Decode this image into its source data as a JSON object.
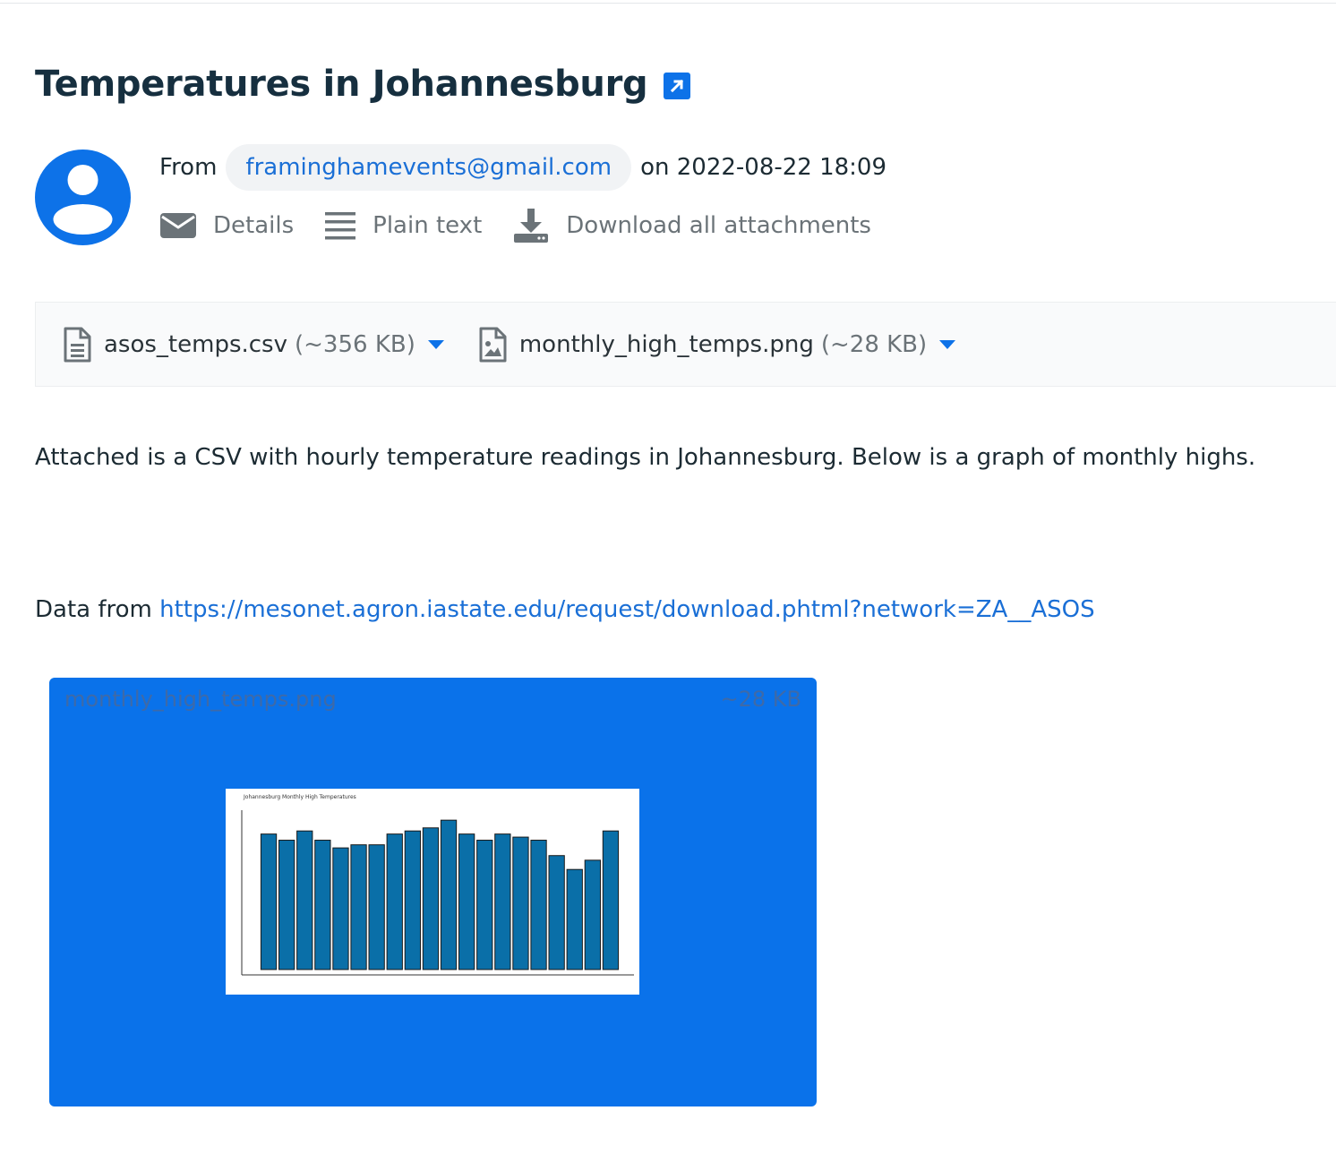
{
  "email": {
    "subject": "Temperatures in Johannesburg",
    "from_label": "From",
    "from_address": "framinghamevents@gmail.com",
    "date_text": "on 2022-08-22 18:09",
    "actions": {
      "details": "Details",
      "plain_text": "Plain text",
      "download_all": "Download all attachments"
    },
    "attachments": [
      {
        "name": "asos_temps.csv",
        "size": "(~356 KB)",
        "icon": "file-text-icon"
      },
      {
        "name": "monthly_high_temps.png",
        "size": "(~28 KB)",
        "icon": "file-image-icon"
      }
    ],
    "body_line": "Attached is a CSV with hourly temperature readings in Johannesburg. Below is a graph of monthly highs.",
    "data_from_label": "Data from ",
    "data_from_link": "https://mesonet.agron.iastate.edu/request/download.phtml?network=ZA__ASOS",
    "preview": {
      "name": "monthly_high_temps.png",
      "size": "~28 KB"
    }
  },
  "colors": {
    "accent": "#0d72e8",
    "link": "#1a6fd6",
    "bar_fill": "#0a6fa8"
  },
  "chart_data": {
    "type": "bar",
    "title": "Johannesburg Monthly High Temperatures",
    "values": [
      0.88,
      0.84,
      0.9,
      0.84,
      0.79,
      0.81,
      0.81,
      0.88,
      0.9,
      0.92,
      0.97,
      0.88,
      0.84,
      0.88,
      0.86,
      0.84,
      0.74,
      0.65,
      0.71,
      0.9
    ],
    "ylim": [
      0,
      1
    ],
    "grid": false
  }
}
